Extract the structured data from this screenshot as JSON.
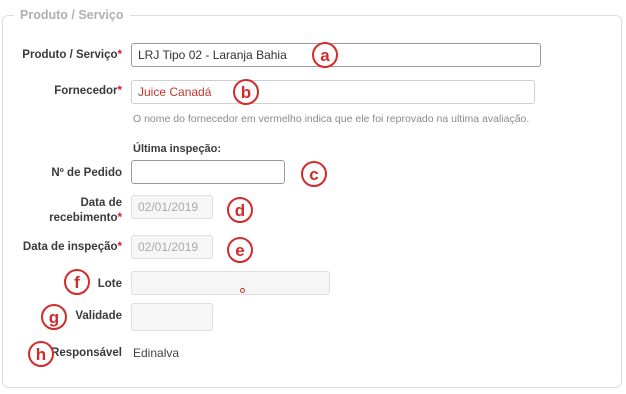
{
  "section": {
    "legend": "Produto / Serviço"
  },
  "fields": {
    "produto": {
      "label": "Produto / Serviço",
      "required": "*",
      "value": "LRJ Tipo 02 - Laranja Bahia"
    },
    "fornecedor": {
      "label": "Fornecedor",
      "required": "*",
      "value": "Juice Canadá",
      "help": "O nome do fornecedor em vermelho indica que ele foi reprovado na ultima avaliação."
    },
    "ultima_inspecao": {
      "label": "Última inspeção:"
    },
    "pedido": {
      "label": "Nº de Pedido",
      "value": ""
    },
    "recebimento": {
      "label_line1": "Data de",
      "label_line2": "recebimento",
      "required": "*",
      "value": "02/01/2019"
    },
    "inspecao": {
      "label": "Data de inspeção",
      "required": "*",
      "value": "02/01/2019"
    },
    "lote": {
      "label": "Lote",
      "value": ""
    },
    "validade": {
      "label": "Validade",
      "value": ""
    },
    "responsavel": {
      "label": "Responsável",
      "value": "Edinalva"
    }
  },
  "annotations": [
    "a",
    "b",
    "c",
    "d",
    "e",
    "f",
    "g",
    "h"
  ],
  "colors": {
    "annotation": "#d42a2a",
    "required": "#d02020",
    "supplier_failed": "#c0392b"
  }
}
